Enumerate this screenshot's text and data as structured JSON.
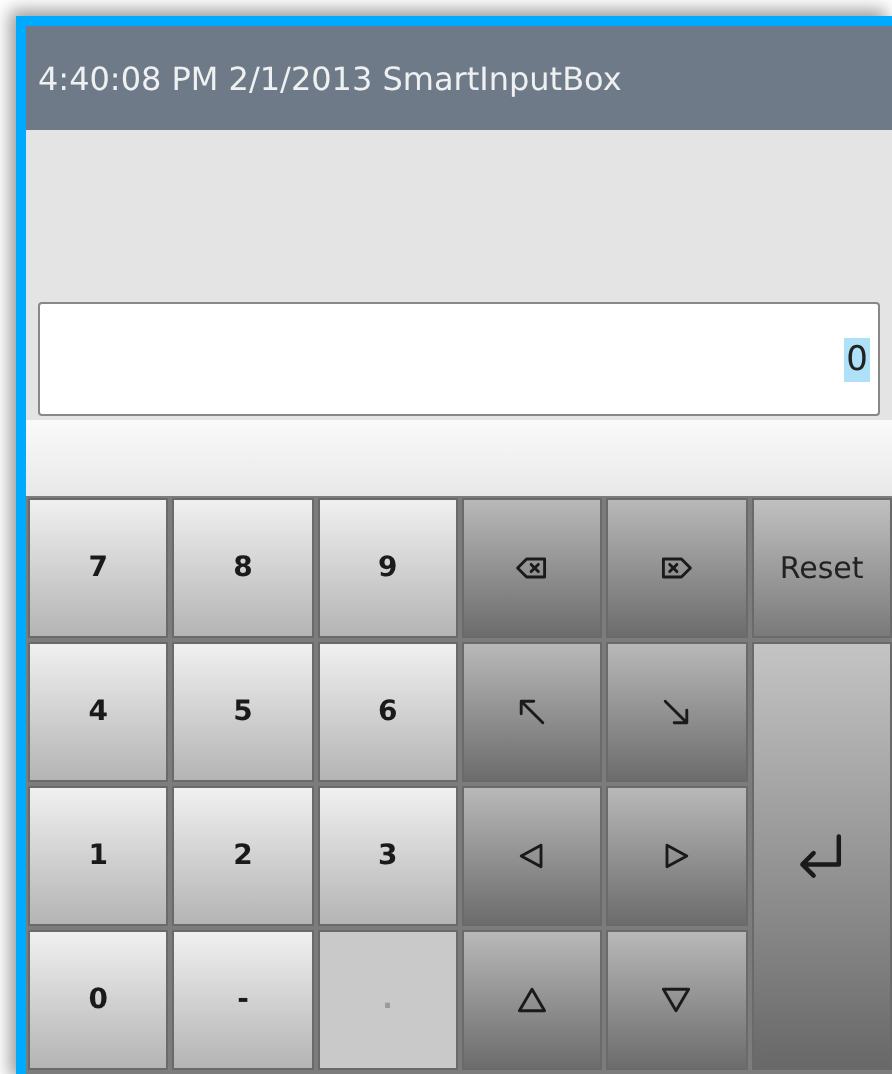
{
  "window": {
    "title": "4:40:08 PM 2/1/2013 SmartInputBox"
  },
  "input": {
    "value": "0",
    "selected": true
  },
  "keys": [
    {
      "kind": "digit",
      "label": "7",
      "disabled": false
    },
    {
      "kind": "digit",
      "label": "8",
      "disabled": false
    },
    {
      "kind": "digit",
      "label": "9",
      "disabled": false
    },
    {
      "kind": "backspace",
      "disabled": false
    },
    {
      "kind": "delete",
      "disabled": false
    },
    {
      "kind": "command",
      "label": "Reset",
      "disabled": false
    },
    {
      "kind": "digit",
      "label": "4",
      "disabled": false
    },
    {
      "kind": "digit",
      "label": "5",
      "disabled": false
    },
    {
      "kind": "digit",
      "label": "6",
      "disabled": false
    },
    {
      "kind": "home",
      "disabled": false
    },
    {
      "kind": "end",
      "disabled": false
    },
    {
      "kind": "enter",
      "disabled": false
    },
    {
      "kind": "digit",
      "label": "1",
      "disabled": false
    },
    {
      "kind": "digit",
      "label": "2",
      "disabled": false
    },
    {
      "kind": "digit",
      "label": "3",
      "disabled": false
    },
    {
      "kind": "left",
      "disabled": false
    },
    {
      "kind": "right",
      "disabled": false
    },
    {
      "kind": "digit",
      "label": "0",
      "disabled": false
    },
    {
      "kind": "digit",
      "label": "-",
      "disabled": false
    },
    {
      "kind": "digit",
      "label": ".",
      "disabled": true
    },
    {
      "kind": "up",
      "disabled": false
    },
    {
      "kind": "down",
      "disabled": false
    }
  ]
}
